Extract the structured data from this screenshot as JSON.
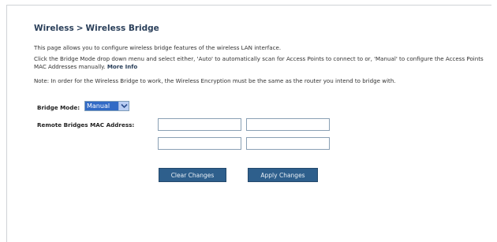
{
  "header": {
    "title_part1": "Wireless",
    "title_sep": ">",
    "title_part2": "Wireless Bridge"
  },
  "content": {
    "intro": "This page allows you to configure wireless bridge features of the wireless LAN interface.",
    "instructions": "Click the Bridge Mode drop down menu and select either, 'Auto' to automatically scan for Access Points to connect to or, 'Manual' to configure the Access Points MAC Addresses manually.",
    "more_info": "More Info",
    "note": "Note: In order for the Wireless Bridge to work, the Wireless Encryption must be the same as the router you intend to bridge with."
  },
  "form": {
    "bridge_mode_label": "Bridge Mode:",
    "bridge_mode_value": "Manual",
    "mac_label": "Remote Bridges MAC Address:",
    "mac_fields": [
      "",
      "",
      "",
      ""
    ]
  },
  "buttons": {
    "clear": "Clear Changes",
    "apply": "Apply Changes"
  },
  "colors": {
    "title": "#2a3f5a",
    "button_bg": "#2e5f8c",
    "select_highlight": "#316ac5"
  }
}
